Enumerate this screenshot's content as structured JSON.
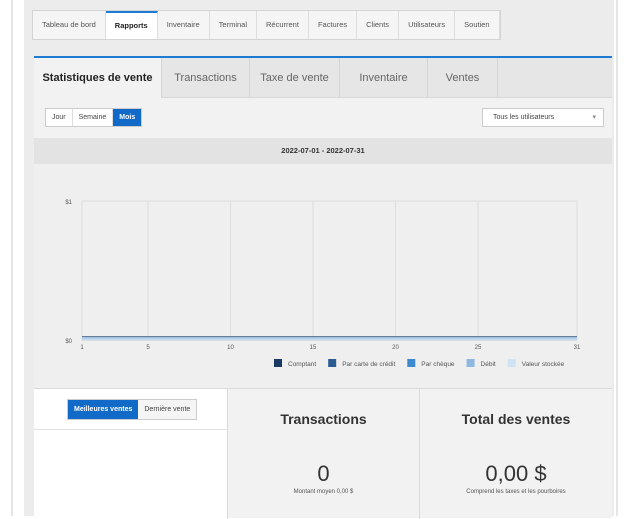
{
  "nav": {
    "tabs": [
      {
        "label": "Tableau de bord"
      },
      {
        "label": "Rapports"
      },
      {
        "label": "Inventaire"
      },
      {
        "label": "Terminal"
      },
      {
        "label": "Récurrent"
      },
      {
        "label": "Factures"
      },
      {
        "label": "Clients"
      },
      {
        "label": "Utilisateurs"
      },
      {
        "label": "Soutien"
      }
    ],
    "active": "Rapports"
  },
  "report_tabs": {
    "tabs": [
      {
        "label": "Statistiques de vente"
      },
      {
        "label": "Transactions"
      },
      {
        "label": "Taxe de vente"
      },
      {
        "label": "Inventaire"
      },
      {
        "label": "Ventes"
      }
    ],
    "active": "Statistiques de vente"
  },
  "period": {
    "options": [
      {
        "label": "Jour"
      },
      {
        "label": "Semaine"
      },
      {
        "label": "Mois"
      }
    ],
    "active": "Mois"
  },
  "user_filter": {
    "value": "Tous les utilisateurs"
  },
  "date_range": "2022-07-01 - 2022-07-31",
  "chart_data": {
    "type": "area",
    "x": [
      1,
      5,
      10,
      15,
      20,
      25,
      31
    ],
    "xticks": [
      "1",
      "5",
      "10",
      "15",
      "20",
      "25",
      "31"
    ],
    "yticks": [
      "$0",
      "$1"
    ],
    "ylim": [
      0,
      1
    ],
    "xlim": [
      1,
      31
    ],
    "grid": true,
    "legend_position": "bottom-right",
    "series": [
      {
        "name": "Comptant",
        "color": "#1a3a63",
        "values": [
          0,
          0,
          0,
          0,
          0,
          0,
          0
        ]
      },
      {
        "name": "Par carte de crédit",
        "color": "#2a5d92",
        "values": [
          0,
          0,
          0,
          0,
          0,
          0,
          0
        ]
      },
      {
        "name": "Par chèque",
        "color": "#3d8ad1",
        "values": [
          0,
          0,
          0,
          0,
          0,
          0,
          0
        ]
      },
      {
        "name": "Débit",
        "color": "#8fb8e0",
        "values": [
          0,
          0,
          0,
          0,
          0,
          0,
          0
        ]
      },
      {
        "name": "Valeur stockée",
        "color": "#cfe3f3",
        "values": [
          0,
          0,
          0,
          0,
          0,
          0,
          0
        ]
      }
    ]
  },
  "bottom": {
    "seg": {
      "options": [
        {
          "label": "Meilleures ventes"
        },
        {
          "label": "Dernière vente"
        }
      ],
      "active": "Meilleures ventes"
    },
    "transactions": {
      "title": "Transactions",
      "value": "0",
      "sub": "Montant moyen 0,00 $"
    },
    "total": {
      "title": "Total des ventes",
      "value": "0,00 $",
      "sub": "Comprend les taxes et les pourboires"
    }
  }
}
